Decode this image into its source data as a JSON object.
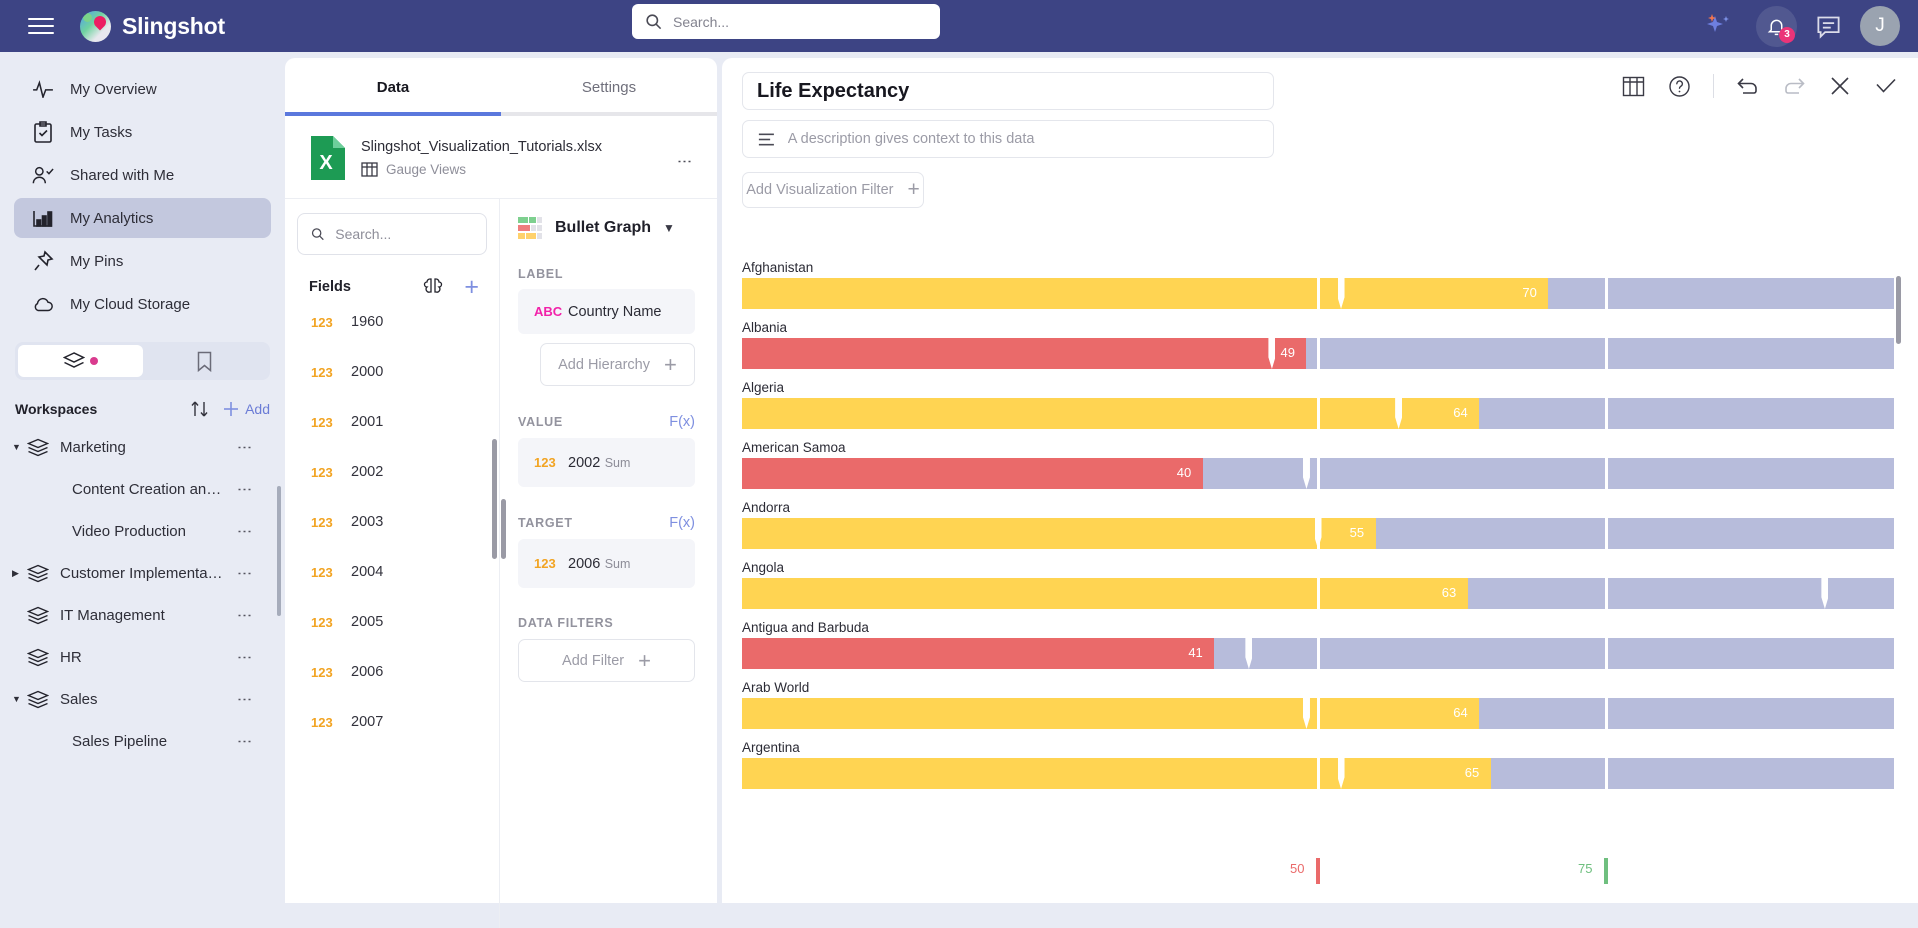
{
  "topbar": {
    "brand": "Slingshot",
    "search_placeholder": "Search...",
    "notification_count": "3",
    "avatar_initial": "J"
  },
  "sidebar": {
    "nav": [
      {
        "label": "My Overview",
        "icon": "pulse-icon",
        "active": false
      },
      {
        "label": "My Tasks",
        "icon": "clipboard-check-icon",
        "active": false
      },
      {
        "label": "Shared with Me",
        "icon": "user-check-icon",
        "active": false
      },
      {
        "label": "My Analytics",
        "icon": "bar-chart-icon",
        "active": true
      },
      {
        "label": "My Pins",
        "icon": "pin-icon",
        "active": false
      },
      {
        "label": "My Cloud Storage",
        "icon": "cloud-icon",
        "active": false
      }
    ],
    "segments": [
      {
        "icon": "layers-icon",
        "active": true
      },
      {
        "icon": "bookmark-icon",
        "active": false
      }
    ],
    "workspaces_title": "Workspaces",
    "add_label": "Add",
    "workspaces": [
      {
        "label": "Marketing",
        "level": 0,
        "expanded": true
      },
      {
        "label": "Content Creation an…",
        "level": 1,
        "expanded": null
      },
      {
        "label": "Video Production",
        "level": 1,
        "expanded": null
      },
      {
        "label": "Customer Implementa…",
        "level": 0,
        "expanded": false
      },
      {
        "label": "IT Management",
        "level": 0,
        "expanded": null
      },
      {
        "label": "HR",
        "level": 0,
        "expanded": null
      },
      {
        "label": "Sales",
        "level": 0,
        "expanded": true
      },
      {
        "label": "Sales Pipeline",
        "level": 1,
        "expanded": null
      }
    ]
  },
  "data_panel": {
    "tabs": [
      {
        "label": "Data",
        "active": true
      },
      {
        "label": "Settings",
        "active": false
      }
    ],
    "file_name": "Slingshot_Visualization_Tutorials.xlsx",
    "sheet_name": "Gauge Views",
    "field_search_placeholder": "Search...",
    "fields_title": "Fields",
    "fields": [
      {
        "type": "123",
        "name": "1960"
      },
      {
        "type": "123",
        "name": "2000"
      },
      {
        "type": "123",
        "name": "2001"
      },
      {
        "type": "123",
        "name": "2002"
      },
      {
        "type": "123",
        "name": "2003"
      },
      {
        "type": "123",
        "name": "2004"
      },
      {
        "type": "123",
        "name": "2005"
      },
      {
        "type": "123",
        "name": "2006"
      },
      {
        "type": "123",
        "name": "2007"
      }
    ],
    "viz_type": "Bullet Graph",
    "label_section": {
      "heading": "LABEL",
      "chip_type": "ABC",
      "chip_title": "Country Name",
      "add_hierarchy": "Add Hierarchy"
    },
    "value_section": {
      "heading": "VALUE",
      "fx": "F(x)",
      "chip_type": "123",
      "chip_title": "2002",
      "chip_sub": "Sum"
    },
    "target_section": {
      "heading": "TARGET",
      "fx": "F(x)",
      "chip_type": "123",
      "chip_title": "2006",
      "chip_sub": "Sum"
    },
    "filters_section": {
      "heading": "DATA FILTERS",
      "add_filter": "Add Filter"
    }
  },
  "chart_panel": {
    "title": "Life Expectancy",
    "description_placeholder": "A description gives context to this data",
    "add_filter_label": "Add Visualization Filter",
    "tools": [
      {
        "name": "table-icon"
      },
      {
        "name": "help-circle-icon"
      },
      {
        "name": "undo-icon"
      },
      {
        "name": "redo-icon"
      },
      {
        "name": "close-icon"
      },
      {
        "name": "check-icon"
      }
    ]
  },
  "chart_data": {
    "type": "bar",
    "variant": "bullet",
    "title": "Life Expectancy",
    "xlabel": "",
    "ylabel": "",
    "value_field": "2002 (Sum)",
    "target_field": "2006 (Sum)",
    "label_field": "Country Name",
    "xlim": [
      0,
      100
    ],
    "axis_max": 100,
    "grid": false,
    "legend": "none",
    "thresholds": [
      {
        "value": 50,
        "color": "#ea6a6a",
        "label": "50"
      },
      {
        "value": 75,
        "color": "#6fbf7f",
        "label": "75"
      }
    ],
    "band_color": "#b7bcdb",
    "good_color": "#ffd452",
    "bad_color": "#ea6a6a",
    "categories": [
      "Afghanistan",
      "Albania",
      "Algeria",
      "American Samoa",
      "Andorra",
      "Angola",
      "Antigua and Barbuda",
      "Arab World",
      "Argentina"
    ],
    "values": [
      70,
      49,
      64,
      40,
      55,
      63,
      41,
      64,
      65
    ],
    "targets": [
      52,
      46,
      57,
      49,
      50,
      94,
      44,
      49,
      52
    ],
    "series": [
      {
        "name": "2002 Sum (value)",
        "values": [
          70,
          49,
          64,
          40,
          55,
          63,
          41,
          64,
          65
        ]
      },
      {
        "name": "2006 Sum (target)",
        "values": [
          52,
          46,
          57,
          49,
          50,
          94,
          44,
          49,
          52
        ]
      }
    ],
    "axis_ticks": [
      {
        "value": 50,
        "label": "50",
        "color": "#ea6a6a"
      },
      {
        "value": 75,
        "label": "75",
        "color": "#6fbf7f"
      }
    ]
  }
}
